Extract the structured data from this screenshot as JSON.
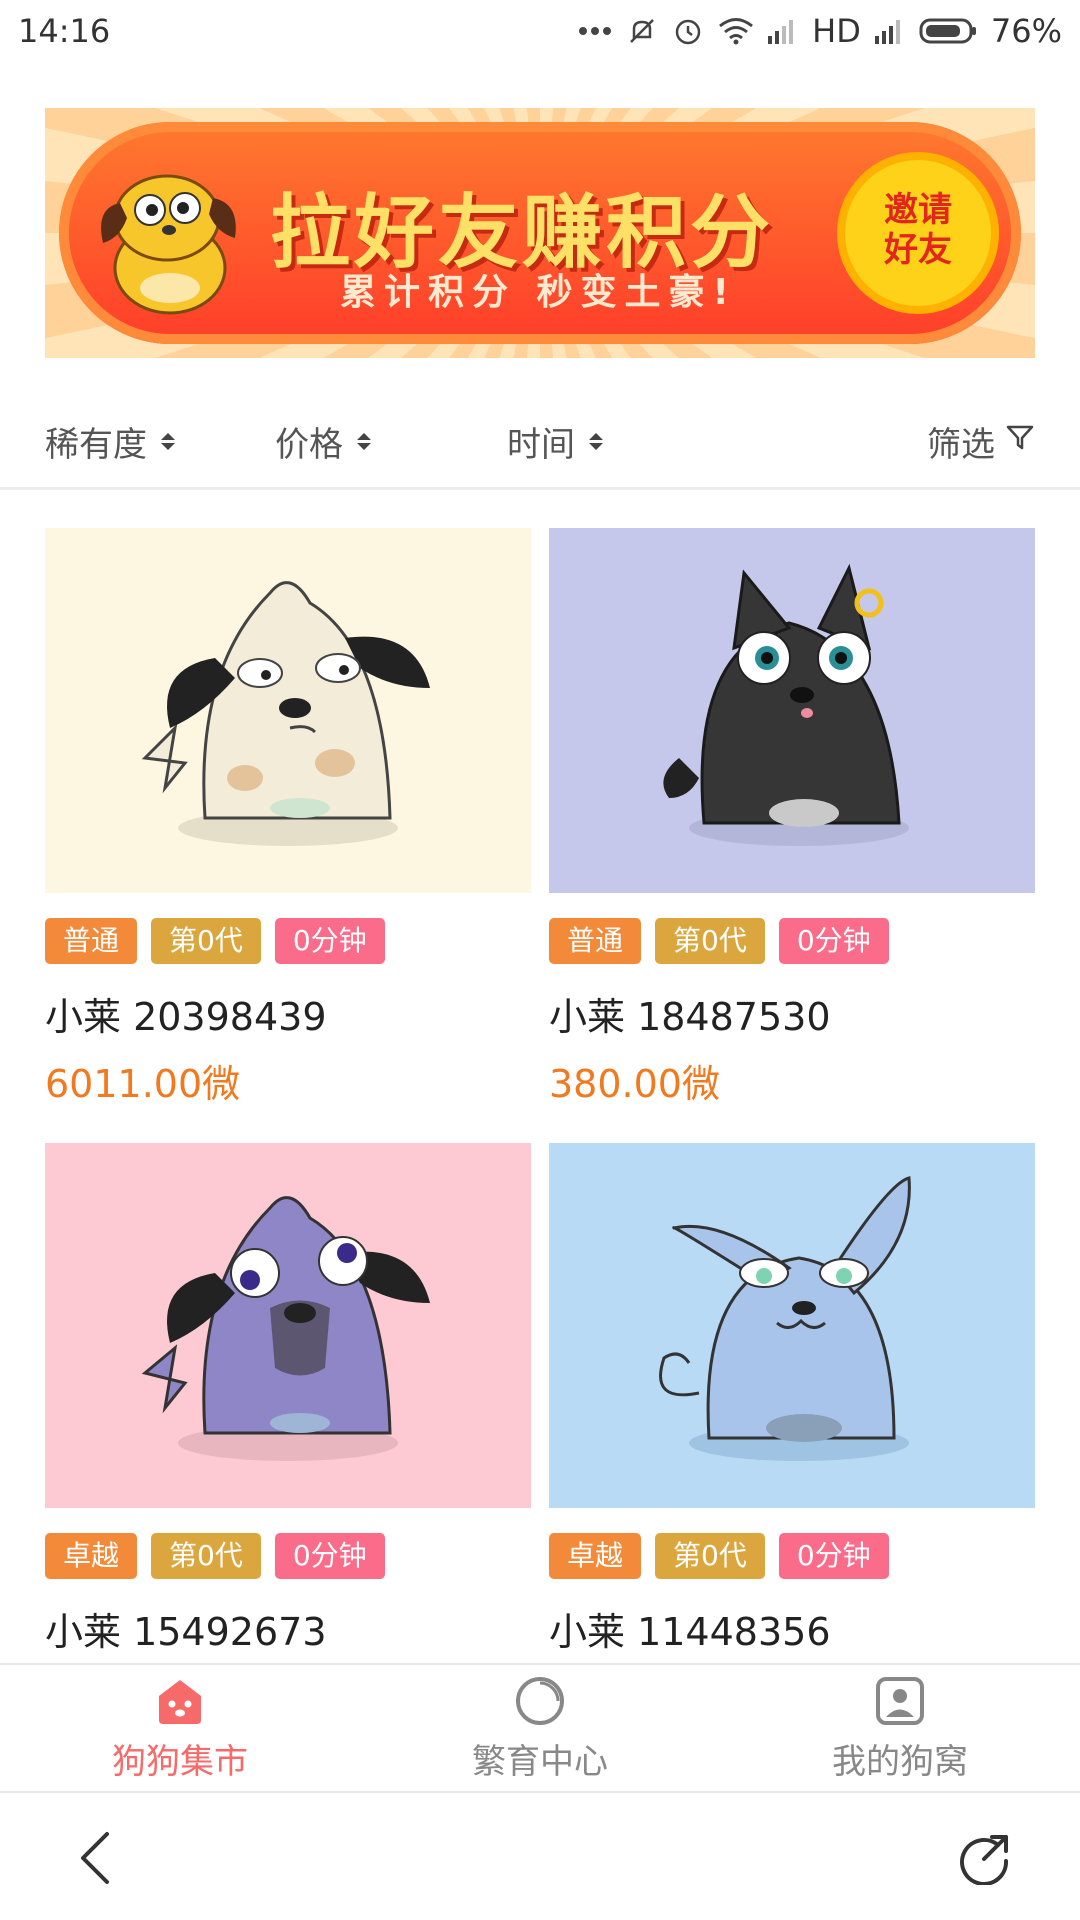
{
  "status_bar": {
    "time": "14:16",
    "network": "HD",
    "battery": "76%",
    "icons": [
      "more-dots-icon",
      "mute-icon",
      "alarm-icon",
      "wifi-icon",
      "signal-icon",
      "signal-icon",
      "battery-icon"
    ]
  },
  "banner": {
    "title": "拉好友赚积分",
    "subtitle": "累计积分 秒变土豪!",
    "invite_label_line1": "邀请",
    "invite_label_line2": "好友",
    "colors": {
      "pill": "#ff3d2a",
      "title": "#ffe067",
      "invite_bg": "#ffd21a"
    }
  },
  "sort_bar": {
    "items": [
      {
        "label": "稀有度"
      },
      {
        "label": "价格"
      },
      {
        "label": "时间"
      }
    ],
    "filter_label": "筛选"
  },
  "listings": [
    {
      "tags": [
        "普通",
        "第0代",
        "0分钟"
      ],
      "name": "小莱 20398439",
      "price": "6011.00微",
      "bg": "#fdf6e1",
      "dog": "white-spotted-dog"
    },
    {
      "tags": [
        "普通",
        "第0代",
        "0分钟"
      ],
      "name": "小莱 18487530",
      "price": "380.00微",
      "bg": "#c5c8ea",
      "dog": "black-dog"
    },
    {
      "tags": [
        "卓越",
        "第0代",
        "0分钟"
      ],
      "name": "小莱 15492673",
      "price": "",
      "bg": "#fdcad3",
      "dog": "purple-dog"
    },
    {
      "tags": [
        "卓越",
        "第0代",
        "0分钟"
      ],
      "name": "小莱 11448356",
      "price": "",
      "bg": "#b9daf5",
      "dog": "blue-cat-dog"
    }
  ],
  "tab_bar": {
    "tabs": [
      {
        "label": "狗狗集市",
        "icon": "dog-face-icon",
        "active": true
      },
      {
        "label": "繁育中心",
        "icon": "circle-icon",
        "active": false
      },
      {
        "label": "我的狗窝",
        "icon": "user-card-icon",
        "active": false
      }
    ],
    "active_color": "#f76a6a"
  },
  "nav_bar": {
    "back_icon": "back-chevron-icon",
    "share_icon": "share-arrow-icon"
  }
}
